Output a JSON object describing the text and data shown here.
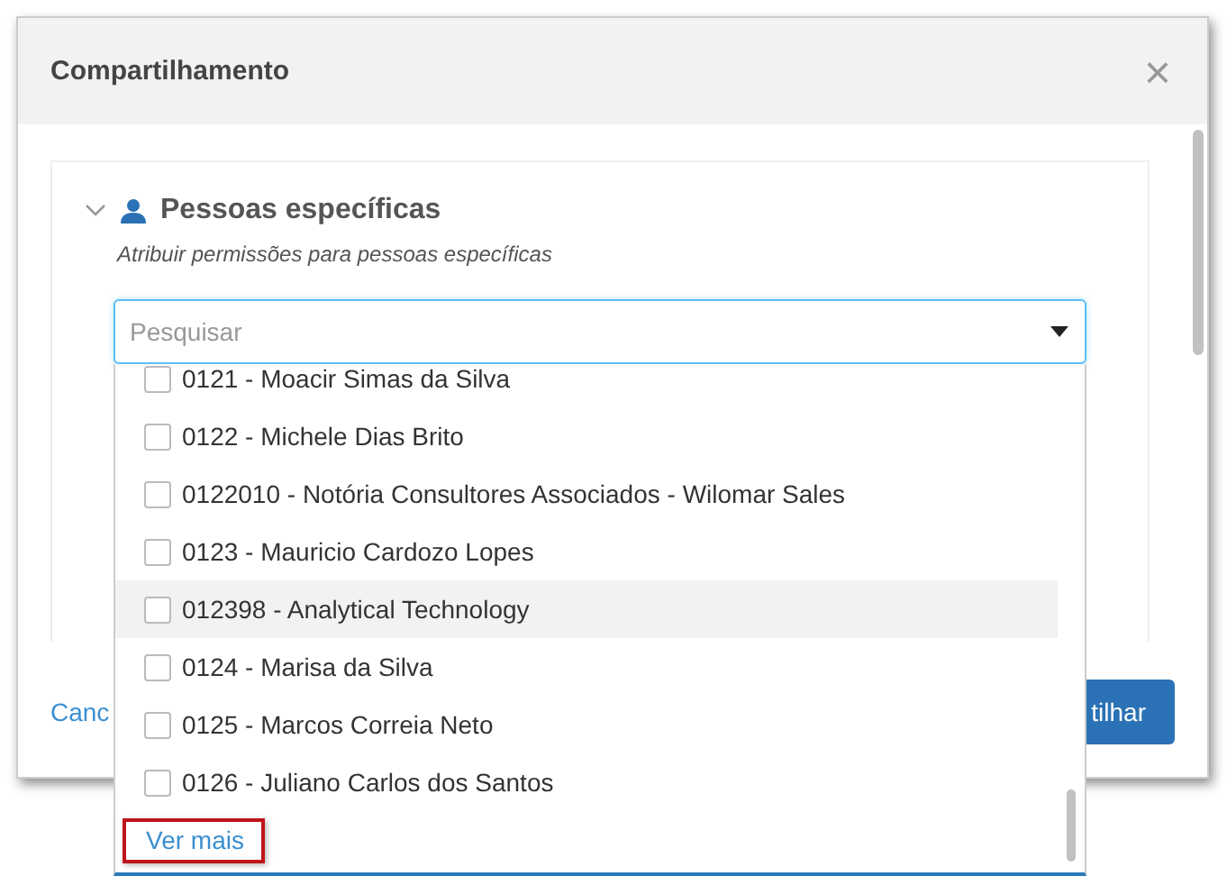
{
  "dialog": {
    "title": "Compartilhamento",
    "close_label": "×"
  },
  "section": {
    "title": "Pessoas específicas",
    "expanded": true,
    "subtitle": "Atribuir permissões para pessoas específicas"
  },
  "search": {
    "placeholder": "Pesquisar"
  },
  "options": [
    {
      "label": "0121 - Moacir Simas da Silva",
      "checked": false,
      "hovered": false
    },
    {
      "label": "0122 - Michele Dias Brito",
      "checked": false,
      "hovered": false
    },
    {
      "label": "0122010 - Notória Consultores Associados - Wilomar Sales",
      "checked": false,
      "hovered": false
    },
    {
      "label": "0123 - Mauricio Cardozo Lopes",
      "checked": false,
      "hovered": false
    },
    {
      "label": "012398 - Analytical Technology",
      "checked": false,
      "hovered": true
    },
    {
      "label": "0124 - Marisa da Silva",
      "checked": false,
      "hovered": false
    },
    {
      "label": "0125 - Marcos Correia Neto",
      "checked": false,
      "hovered": false
    },
    {
      "label": "0126 - Juliano Carlos dos Santos",
      "checked": false,
      "hovered": false
    }
  ],
  "more_link": {
    "label": "Ver mais",
    "annotated": true
  },
  "footer": {
    "cancel": "Canc",
    "confirm": "tilhar"
  }
}
